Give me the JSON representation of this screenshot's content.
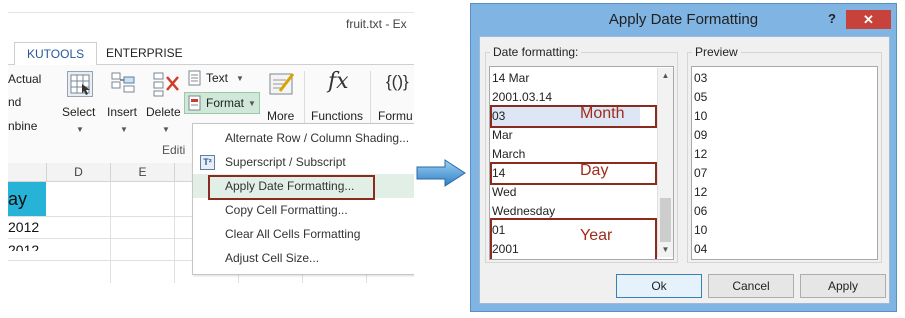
{
  "excel": {
    "window_title": "fruit.txt - Ex",
    "tabs": [
      "KUTOOLS",
      "ENTERPRISE"
    ],
    "left_labels": [
      "Actual",
      "nd",
      "nbine"
    ],
    "ribbon": {
      "select_label": "Select",
      "insert_label": "Insert",
      "delete_label": "Delete",
      "text_label": "Text",
      "format_label": "Format",
      "more_label": "More",
      "functions_label": "Functions",
      "formula_label": "Formu",
      "functions_icon_glyph": "fx",
      "formula_icon_glyph": "{()}",
      "group_label": "Editi"
    },
    "columns": [
      "D",
      "E"
    ],
    "cell_text": "ay",
    "cell_values": [
      "2012",
      "2012"
    ],
    "menu": {
      "items": [
        "Alternate Row / Column Shading...",
        "Superscript / Subscript",
        "Apply Date Formatting...",
        "Copy Cell Formatting...",
        "Clear All Cells Formatting",
        "Adjust Cell Size..."
      ]
    }
  },
  "dialog": {
    "title": "Apply Date Formatting",
    "help_glyph": "?",
    "close_glyph": "✕",
    "date_formatting_label": "Date formatting:",
    "preview_label": "Preview",
    "date_formats": [
      "14 Mar",
      "2001.03.14",
      "03",
      "Mar",
      "March",
      "14",
      "Wed",
      "Wednesday",
      "01",
      "2001"
    ],
    "selected_index": 2,
    "preview": [
      "03",
      "05",
      "10",
      "09",
      "12",
      "07",
      "12",
      "06",
      "10",
      "04"
    ],
    "annotations": [
      "Month",
      "Day",
      "Year"
    ],
    "buttons": {
      "ok": "Ok",
      "cancel": "Cancel",
      "apply": "Apply"
    }
  },
  "colors": {
    "annotation": "#8b2b1f",
    "dialog_frame": "#7fb4e3",
    "close_button": "#c7423a",
    "highlight_cell": "#27b3d8",
    "arrow": "#3b8ed3"
  }
}
